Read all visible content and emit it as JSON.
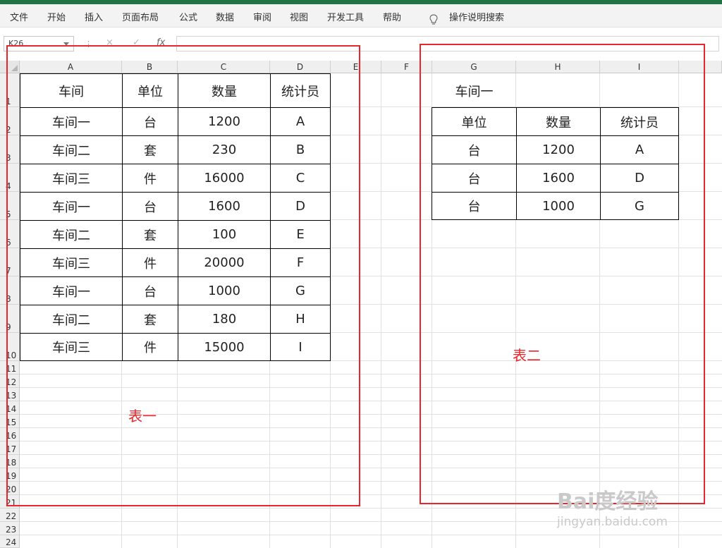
{
  "menu": [
    "文件",
    "开始",
    "插入",
    "页面布局",
    "公式",
    "数据",
    "审阅",
    "视图",
    "开发工具",
    "帮助"
  ],
  "search_hint": "操作说明搜索",
  "formula_bar": {
    "name_box": "K26",
    "fx": "fx",
    "cancel": "×",
    "enter": "✓"
  },
  "columns": [
    "A",
    "B",
    "C",
    "D",
    "E",
    "F",
    "G",
    "H",
    "I"
  ],
  "rows": [
    "1",
    "2",
    "3",
    "4",
    "5",
    "6",
    "7",
    "8",
    "9",
    "10",
    "11",
    "12",
    "13",
    "14",
    "15",
    "16",
    "17",
    "18",
    "19",
    "20",
    "21",
    "22",
    "23",
    "24"
  ],
  "table1": {
    "headers": [
      "车间",
      "单位",
      "数量",
      "统计员"
    ],
    "rows": [
      [
        "车间一",
        "台",
        "1200",
        "A"
      ],
      [
        "车间二",
        "套",
        "230",
        "B"
      ],
      [
        "车间三",
        "件",
        "16000",
        "C"
      ],
      [
        "车间一",
        "台",
        "1600",
        "D"
      ],
      [
        "车间二",
        "套",
        "100",
        "E"
      ],
      [
        "车间三",
        "件",
        "20000",
        "F"
      ],
      [
        "车间一",
        "台",
        "1000",
        "G"
      ],
      [
        "车间二",
        "套",
        "180",
        "H"
      ],
      [
        "车间三",
        "件",
        "15000",
        "I"
      ]
    ],
    "label": "表一"
  },
  "table2": {
    "title": "车间一",
    "headers": [
      "单位",
      "数量",
      "统计员"
    ],
    "rows": [
      [
        "台",
        "1200",
        "A"
      ],
      [
        "台",
        "1600",
        "D"
      ],
      [
        "台",
        "1000",
        "G"
      ]
    ],
    "label": "表二"
  },
  "watermark": {
    "brand": "Bai度经验",
    "url": "jingyan.baidu.com"
  },
  "colors": {
    "accent": "#217346",
    "highlight": "#e8262b"
  }
}
